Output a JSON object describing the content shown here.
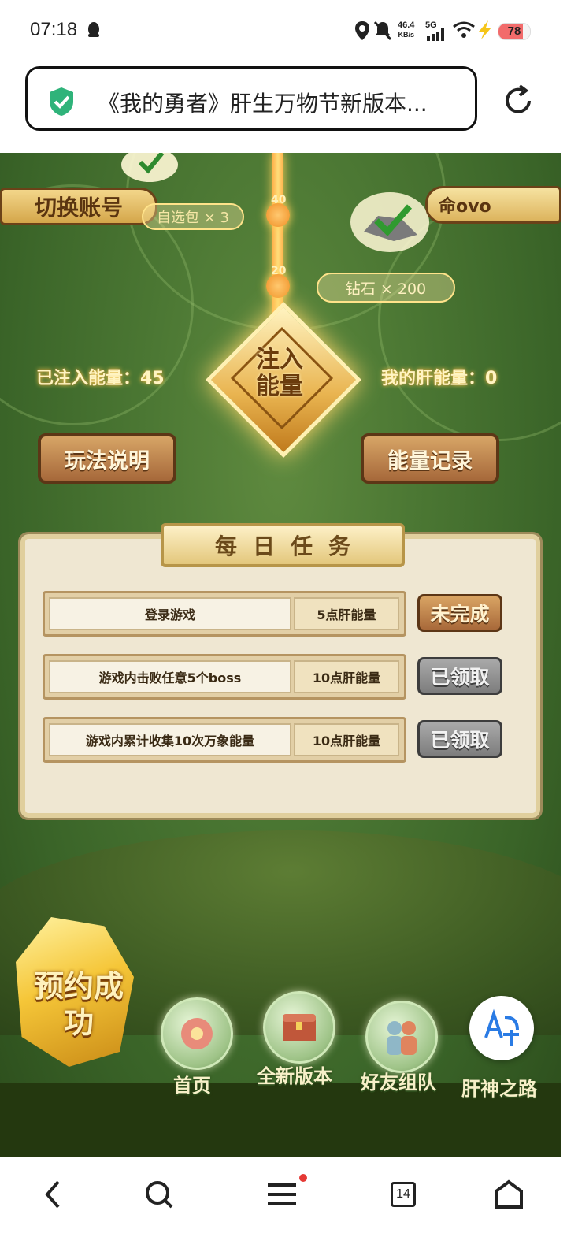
{
  "status_bar": {
    "time": "07:18",
    "net_speed_value": "46.4",
    "net_speed_unit": "KB/s",
    "network": "5G",
    "battery": "78",
    "battery_level": 0.78
  },
  "url_bar": {
    "title": "《我的勇者》肝生万物节新版本..."
  },
  "game": {
    "switch_account_label": "切换账号",
    "username": "命ovo",
    "rewards": [
      {
        "label": "自选包 × 3",
        "node": "40"
      },
      {
        "label": "钻石 × 200",
        "node": "20"
      }
    ],
    "inject_button_label": "注入能量",
    "energy_injected_label": "已注入能量：45",
    "my_energy_label": "我的肝能量：0",
    "rules_button_label": "玩法说明",
    "records_button_label": "能量记录",
    "daily_tasks": {
      "title": "每日任务",
      "tasks": [
        {
          "name": "登录游戏",
          "reward": "5点肝能量",
          "status": "未完成"
        },
        {
          "name": "游戏内击败任意5个boss",
          "reward": "10点肝能量",
          "status": "已领取"
        },
        {
          "name": "游戏内累计收集10次万象能量",
          "reward": "10点肝能量",
          "status": "已领取"
        }
      ]
    },
    "reservation_label": "预约成功",
    "nav": [
      {
        "label": "首页"
      },
      {
        "label": "全新版本"
      },
      {
        "label": "好友组队"
      },
      {
        "label": "肝神之路"
      }
    ]
  },
  "browser_nav": {
    "tab_count": "14"
  }
}
